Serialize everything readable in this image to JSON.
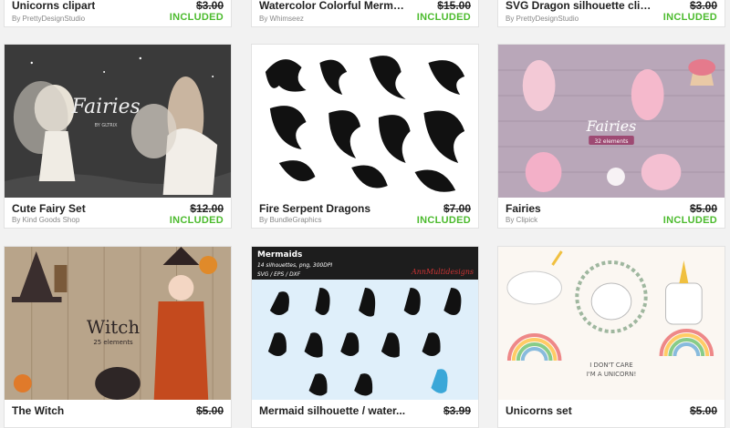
{
  "products": [
    {
      "title": "Unicorns clipart",
      "author": "By PrettyDesignStudio",
      "old_price": "$3.00",
      "badge": "INCLUDED"
    },
    {
      "title": "Watercolor Colorful Mermai...",
      "author": "By Whimseez",
      "old_price": "$15.00",
      "badge": "INCLUDED"
    },
    {
      "title": "SVG Dragon silhouette clip art",
      "author": "By PrettyDesignStudio",
      "old_price": "$3.00",
      "badge": "INCLUDED"
    },
    {
      "title": "Cute Fairy Set",
      "author": "By Kind Goods Shop",
      "old_price": "$12.00",
      "badge": "INCLUDED",
      "image_text": [
        "Fairies",
        "BY GLTRIX"
      ]
    },
    {
      "title": "Fire Serpent Dragons",
      "author": "By BundleGraphics",
      "old_price": "$7.00",
      "badge": "INCLUDED"
    },
    {
      "title": "Fairies",
      "author": "By Clipick",
      "old_price": "$5.00",
      "badge": "INCLUDED",
      "image_text": [
        "Fairies",
        "32 elements"
      ]
    },
    {
      "title": "The Witch",
      "author": "",
      "old_price": "$5.00",
      "badge": "",
      "image_text": [
        "Witch",
        "25 elements"
      ]
    },
    {
      "title": "Mermaid silhouette / water...",
      "author": "",
      "old_price": "$3.99",
      "badge": "",
      "image_text": [
        "Mermaids",
        "14 silhouettes, png, 300DPI",
        "SVG / EPS / DXF",
        "AnnMultidesigns"
      ]
    },
    {
      "title": "Unicorns set",
      "author": "",
      "old_price": "$5.00",
      "badge": "",
      "image_text": [
        "I DON'T CARE",
        "I'M A UNICORN!"
      ]
    }
  ],
  "colors": {
    "included": "#4cbb2e",
    "card_bg": "#ffffff",
    "page_bg": "#f2f2f2"
  }
}
